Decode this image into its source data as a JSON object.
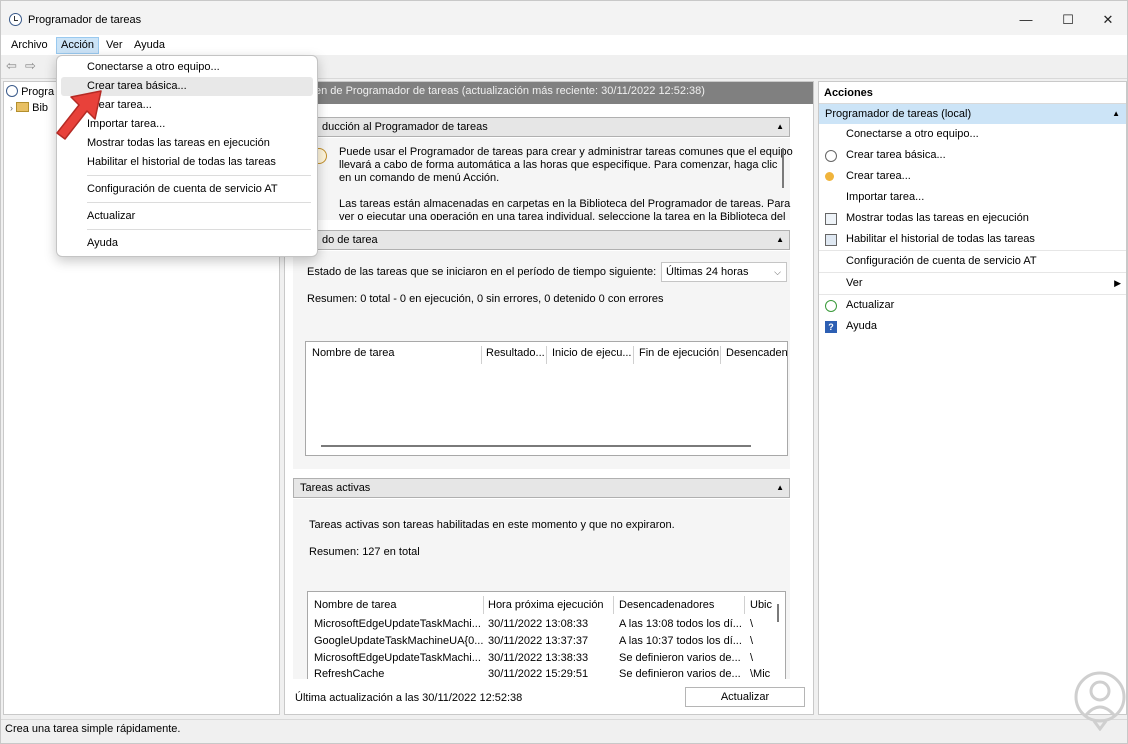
{
  "window": {
    "title": "Programador de tareas",
    "controls": {
      "minimize": "—",
      "maximize": "☐",
      "close": "✕"
    }
  },
  "menubar": {
    "items": [
      "Archivo",
      "Acción",
      "Ver",
      "Ayuda"
    ]
  },
  "context_menu": {
    "items": [
      "Conectarse a otro equipo...",
      "Crear tarea básica...",
      "Crear tarea...",
      "Importar tarea...",
      "Mostrar todas las tareas en ejecución",
      "Habilitar el historial de todas las tareas",
      "Configuración de cuenta de servicio AT",
      "Actualizar",
      "Ayuda"
    ]
  },
  "tree": {
    "root_label": "Progra",
    "child_label": "Bib"
  },
  "center": {
    "header": "en de Programador de tareas (actualización más reciente: 30/11/2022 12:52:38)",
    "intro": {
      "title": "ducción al Programador de tareas",
      "p1_line1": "Puede usar el Programador de tareas para crear y administrar tareas comunes que el equipo",
      "p1_line2": "llevará a cabo de forma automática a las horas que especifique. Para comenzar, haga clic",
      "p1_line3": "en un comando de menú Acción.",
      "p2_line1": "Las tareas están almacenadas en carpetas en la Biblioteca del Programador de tareas. Para",
      "p2_line2": "ver o ejecutar una operación en una tarea individual, seleccione la tarea en la Biblioteca del"
    },
    "status": {
      "title": "do de tarea",
      "period_label": "Estado de las tareas que se iniciaron en el período de tiempo siguiente:",
      "period_value": "Últimas 24 horas",
      "summary": "Resumen: 0 total - 0 en ejecución, 0 sin errores, 0 detenido  0 con errores",
      "columns": [
        "Nombre de tarea",
        "Resultado...",
        "Inicio de ejecu...",
        "Fin de ejecución",
        "Desencadena"
      ]
    },
    "active": {
      "title": "Tareas activas",
      "description": "Tareas activas son tareas habilitadas en este momento y que no expiraron.",
      "summary": "Resumen: 127 en total",
      "columns": [
        "Nombre de tarea",
        "Hora próxima ejecución",
        "Desencadenadores",
        "Ubic"
      ],
      "rows": [
        [
          "MicrosoftEdgeUpdateTaskMachi...",
          "30/11/2022 13:08:33",
          "A las 13:08 todos los dí...",
          "\\"
        ],
        [
          "GoogleUpdateTaskMachineUA{0...",
          "30/11/2022 13:37:37",
          "A las 10:37 todos los dí...",
          "\\"
        ],
        [
          "MicrosoftEdgeUpdateTaskMachi...",
          "30/11/2022 13:38:33",
          "Se definieron varios de...",
          "\\"
        ],
        [
          "RefreshCache",
          "30/11/2022 15:29:51",
          "Se definieron varios de...",
          "\\Mic"
        ]
      ]
    },
    "last_update": "Última actualización a las 30/11/2022 12:52:38",
    "update_button": "Actualizar"
  },
  "actions": {
    "title": "Acciones",
    "group": "Programador de tareas (local)",
    "items": [
      "Conectarse a otro equipo...",
      "Crear tarea básica...",
      "Crear tarea...",
      "Importar tarea...",
      "Mostrar todas las tareas en ejecución",
      "Habilitar el historial de todas las tareas",
      "Configuración de cuenta de servicio AT",
      "Ver",
      "Actualizar",
      "Ayuda"
    ]
  },
  "statusbar": {
    "text": "Crea una tarea simple rápidamente."
  },
  "colors": {
    "header_gray": "#808080",
    "selection_blue": "#cce4f7",
    "arrow_red": "#e8413a"
  }
}
